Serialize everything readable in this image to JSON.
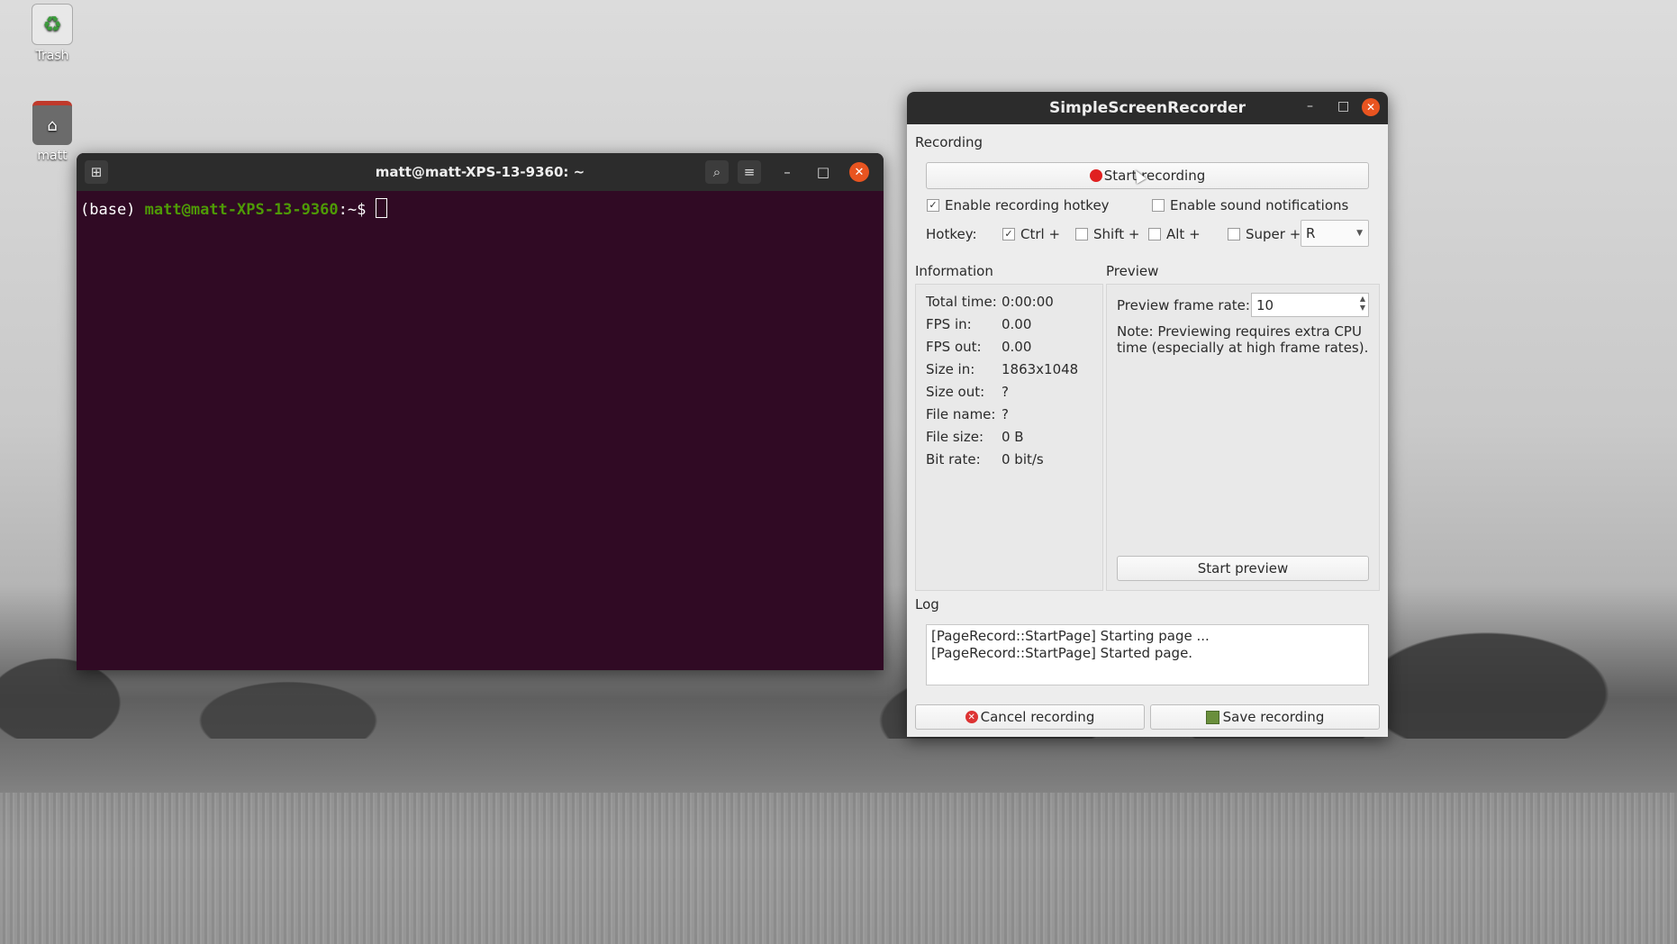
{
  "desktop": {
    "icons": [
      {
        "label": "Trash",
        "icon": "trash-icon"
      },
      {
        "label": "matt",
        "icon": "home-folder-icon"
      }
    ]
  },
  "terminal": {
    "title": "matt@matt-XPS-13-9360: ~",
    "prompt_env": "(base) ",
    "prompt_user_host": "matt@matt-XPS-13-9360",
    "prompt_path": ":~$ ",
    "background": "#300a24"
  },
  "ssr": {
    "title": "SimpleScreenRecorder",
    "recording": {
      "group_title": "Recording",
      "start_button": "Start recording",
      "enable_hotkey": {
        "label": "Enable recording hotkey",
        "checked": true
      },
      "enable_sound": {
        "label": "Enable sound notifications",
        "checked": false
      },
      "hotkey_label": "Hotkey:",
      "ctrl": {
        "label": "Ctrl +",
        "checked": true
      },
      "shift": {
        "label": "Shift +",
        "checked": false
      },
      "alt": {
        "label": "Alt +",
        "checked": false
      },
      "super": {
        "label": "Super +",
        "checked": false
      },
      "key_value": "R"
    },
    "information": {
      "group_title": "Information",
      "rows": [
        {
          "k": "Total time:",
          "v": "0:00:00"
        },
        {
          "k": "FPS in:",
          "v": "0.00"
        },
        {
          "k": "FPS out:",
          "v": "0.00"
        },
        {
          "k": "Size in:",
          "v": "1863x1048"
        },
        {
          "k": "Size out:",
          "v": "?"
        },
        {
          "k": "File name:",
          "v": "?"
        },
        {
          "k": "File size:",
          "v": "0 B"
        },
        {
          "k": "Bit rate:",
          "v": "0 bit/s"
        }
      ]
    },
    "preview": {
      "group_title": "Preview",
      "frame_rate_label": "Preview frame rate:",
      "frame_rate_value": "10",
      "note": "Note: Previewing requires extra CPU time (especially at high frame rates).",
      "start_button": "Start preview"
    },
    "log": {
      "group_title": "Log",
      "lines": [
        "[PageRecord::StartPage] Starting page ...",
        "[PageRecord::StartPage] Started page."
      ]
    },
    "cancel_button": "Cancel recording",
    "save_button": "Save recording"
  },
  "colors": {
    "accent": "#e95420",
    "record_red": "#e02020"
  }
}
